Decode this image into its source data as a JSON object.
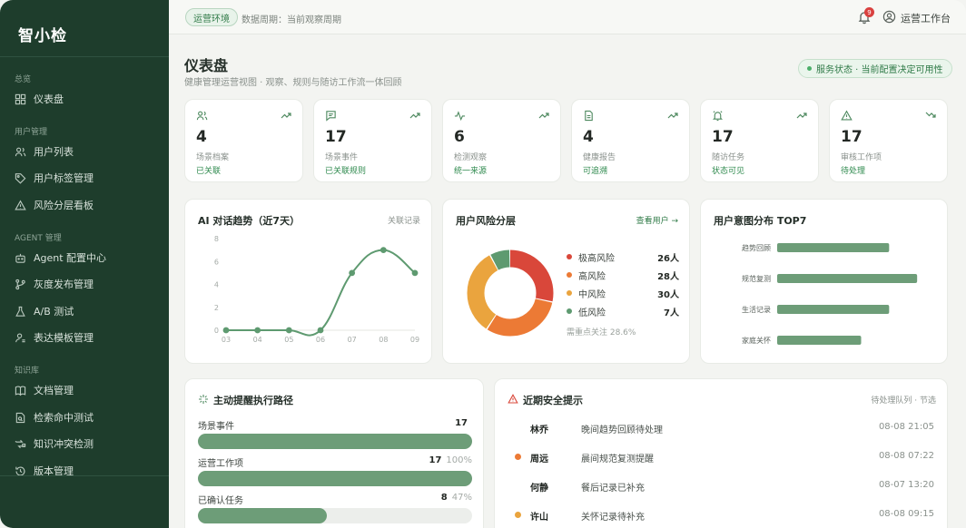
{
  "sidebar": {
    "logo": "智小检",
    "sections": [
      {
        "title": "总览",
        "items": [
          {
            "label": "仪表盘",
            "icon": "dashboard-icon"
          }
        ]
      },
      {
        "title": "用户管理",
        "items": [
          {
            "label": "用户列表",
            "icon": "users-icon"
          },
          {
            "label": "用户标签管理",
            "icon": "tag-icon"
          },
          {
            "label": "风险分层看板",
            "icon": "warning-icon"
          }
        ]
      },
      {
        "title": "AGENT 管理",
        "items": [
          {
            "label": "Agent 配置中心",
            "icon": "robot-icon"
          },
          {
            "label": "灰度发布管理",
            "icon": "branch-icon"
          },
          {
            "label": "A/B 测试",
            "icon": "flask-icon"
          },
          {
            "label": "表达模板管理",
            "icon": "user-template-icon"
          }
        ]
      },
      {
        "title": "知识库",
        "items": [
          {
            "label": "文档管理",
            "icon": "book-icon"
          },
          {
            "label": "检索命中测试",
            "icon": "search-doc-icon"
          },
          {
            "label": "知识冲突检测",
            "icon": "conflict-icon"
          },
          {
            "label": "版本管理",
            "icon": "history-icon"
          }
        ]
      }
    ]
  },
  "topbar": {
    "env": "运营环境",
    "period": "数据周期：当前观察周期",
    "notification_count": "9",
    "user": "运营工作台"
  },
  "page": {
    "title": "仪表盘",
    "subtitle": "健康管理运营视图 · 观察、规则与随访工作流一体回顾",
    "status": "服务状态 · 当前配置决定可用性"
  },
  "stats": [
    {
      "icon": "users-icon",
      "value": "4",
      "label": "场景档案",
      "tag": "已关联",
      "trend": "up"
    },
    {
      "icon": "message-icon",
      "value": "17",
      "label": "场景事件",
      "tag": "已关联规则",
      "trend": "up"
    },
    {
      "icon": "pulse-icon",
      "value": "6",
      "label": "检测观察",
      "tag": "统一来源",
      "trend": "up"
    },
    {
      "icon": "report-icon",
      "value": "4",
      "label": "健康报告",
      "tag": "可追溯",
      "trend": "up"
    },
    {
      "icon": "alarm-icon",
      "value": "17",
      "label": "随访任务",
      "tag": "状态可见",
      "trend": "up"
    },
    {
      "icon": "alert-icon",
      "value": "17",
      "label": "审核工作项",
      "tag": "待处理",
      "trend": "down"
    }
  ],
  "ai_trend": {
    "title": "AI 对话趋势（近7天）",
    "link": "关联记录",
    "chart_data": {
      "type": "line",
      "x": [
        "03",
        "04",
        "05",
        "06",
        "07",
        "08",
        "09"
      ],
      "values": [
        0,
        0,
        0,
        0,
        5,
        7,
        5
      ],
      "yticks": [
        0,
        2,
        4,
        6,
        8
      ],
      "ylim": [
        0,
        8
      ],
      "color": "#5e9a70"
    }
  },
  "risk": {
    "title": "用户风险分层",
    "link": "查看用户 →",
    "focus": "需重点关注 28.6%",
    "chart_data": {
      "type": "pie",
      "series": [
        {
          "name": "极高风险",
          "value": 26,
          "label": "26人",
          "color": "#d9473a"
        },
        {
          "name": "高风险",
          "value": 28,
          "label": "28人",
          "color": "#ec7a35"
        },
        {
          "name": "中风险",
          "value": 30,
          "label": "30人",
          "color": "#eaa43e"
        },
        {
          "name": "低风险",
          "value": 7,
          "label": "7人",
          "color": "#5e9a70"
        }
      ]
    }
  },
  "intent": {
    "title": "用户意图分布 TOP7",
    "chart_data": {
      "type": "bar",
      "orientation": "horizontal",
      "categories": [
        "趋势回顾",
        "规范复测",
        "生活记录",
        "家庭关怀"
      ],
      "values": [
        4,
        5,
        4,
        3
      ],
      "xlim": [
        0,
        6
      ],
      "color": "#6d9d78"
    }
  },
  "exec": {
    "title": "主动提醒执行路径",
    "rows": [
      {
        "name": "场景事件",
        "count": "17",
        "pct": "",
        "ratio": 1.0
      },
      {
        "name": "运营工作项",
        "count": "17",
        "pct": "100%",
        "ratio": 1.0
      },
      {
        "name": "已确认任务",
        "count": "8",
        "pct": "47%",
        "ratio": 0.47
      }
    ]
  },
  "alerts": {
    "title": "近期安全提示",
    "link": "待处理队列 · 节选",
    "items": [
      {
        "name": "林乔",
        "text": "晚间趋势回顾待处理",
        "time": "08-08 21:05",
        "color": ""
      },
      {
        "name": "周远",
        "text": "晨间规范复测提醒",
        "time": "08-08 07:22",
        "color": "#ec7a35"
      },
      {
        "name": "何静",
        "text": "餐后记录已补充",
        "time": "08-07 13:20",
        "color": ""
      },
      {
        "name": "许山",
        "text": "关怀记录待补充",
        "time": "08-08 09:15",
        "color": "#eaa43e"
      }
    ]
  }
}
